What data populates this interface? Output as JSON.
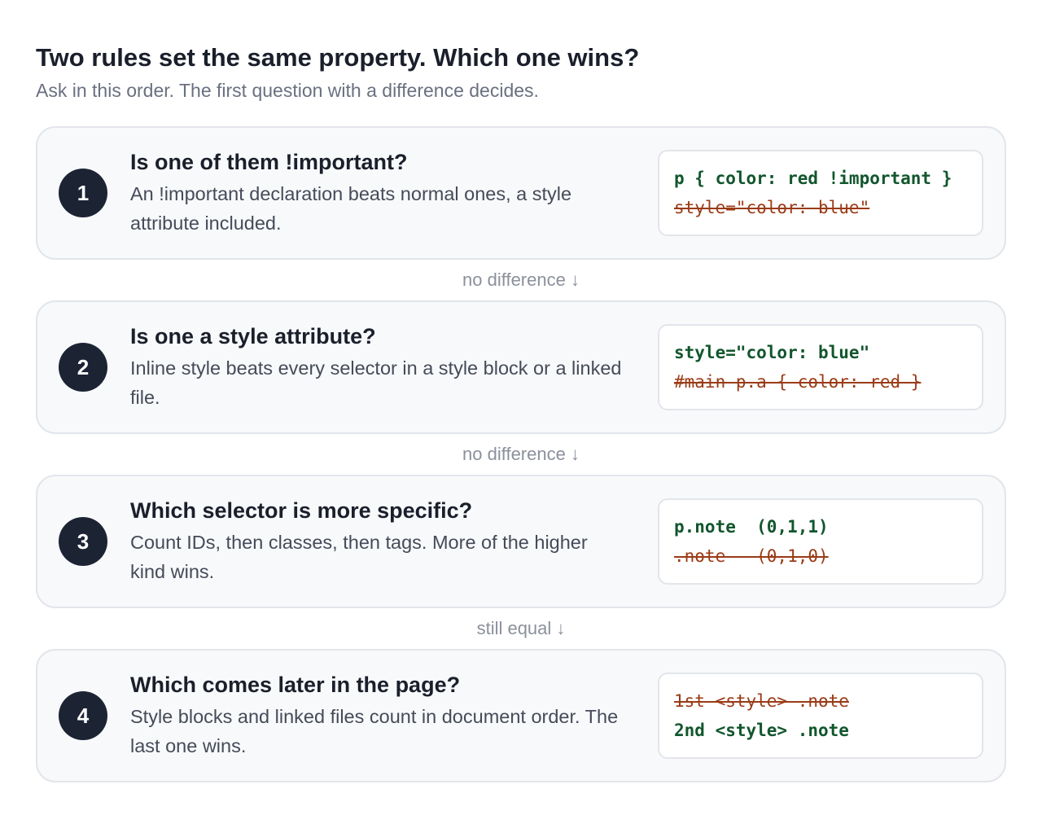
{
  "header": {
    "title": "Two rules set the same property. Which one wins?",
    "subtitle": "Ask in this order. The first question with a difference decides."
  },
  "steps": [
    {
      "number": "1",
      "question": "Is one of them !important?",
      "answer": "An !important declaration beats normal ones, a style attribute included.",
      "code": [
        {
          "text": "p { color: red !important }",
          "status": "winner"
        },
        {
          "text": "style=\"color: blue\"",
          "status": "loser"
        }
      ]
    },
    {
      "number": "2",
      "question": "Is one a style attribute?",
      "answer": "Inline style beats every selector in a style block or a linked file.",
      "code": [
        {
          "text": "style=\"color: blue\"",
          "status": "winner"
        },
        {
          "text": "#main p.a { color: red }",
          "status": "loser"
        }
      ]
    },
    {
      "number": "3",
      "question": "Which selector is more specific?",
      "answer": "Count IDs, then classes, then tags. More of the higher kind wins.",
      "code": [
        {
          "text": "p.note  (0,1,1)",
          "status": "winner"
        },
        {
          "text": ".note   (0,1,0)",
          "status": "loser"
        }
      ]
    },
    {
      "number": "4",
      "question": "Which comes later in the page?",
      "answer": "Style blocks and linked files count in document order. The last one wins.",
      "code": [
        {
          "text": "1st <style> .note",
          "status": "loser"
        },
        {
          "text": "2nd <style> .note",
          "status": "winner"
        }
      ]
    }
  ],
  "connectors": [
    "no difference ↓",
    "no difference ↓",
    "still equal ↓"
  ],
  "colors": {
    "winner": "#12562d",
    "loser": "#9a3b16",
    "badge": "#1c2434",
    "card_bg": "#f8f9fb",
    "card_border": "#e2e5ea"
  }
}
